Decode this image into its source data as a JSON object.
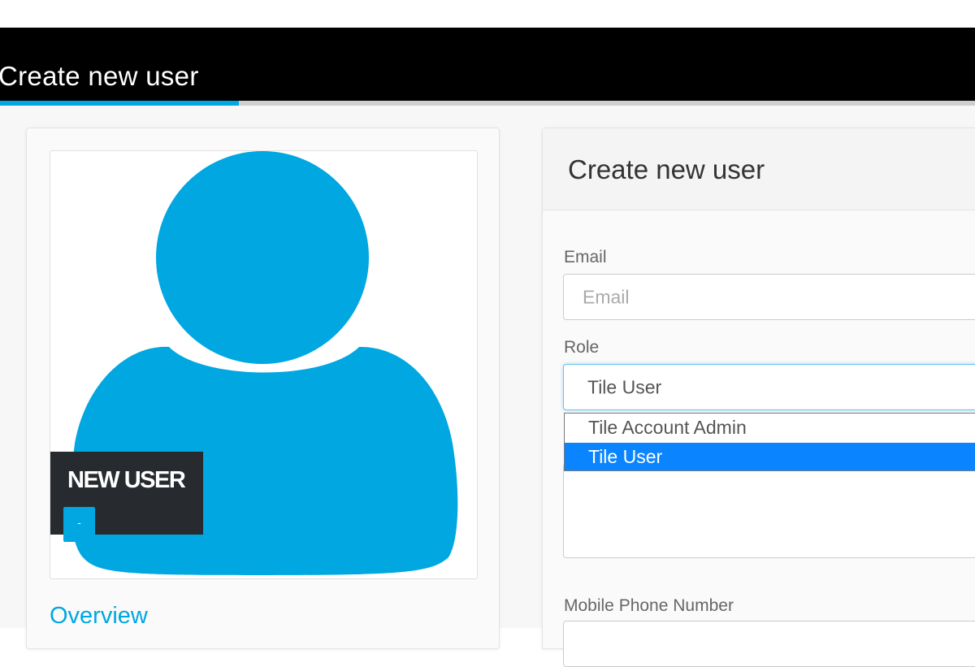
{
  "page": {
    "title": "Create new user"
  },
  "progress": {
    "fraction": 0.245,
    "accent": "#00a7e1"
  },
  "profile": {
    "avatar_icon": "user-silhouette-icon",
    "name": "NEW USER",
    "badge": "-",
    "overview_link": "Overview"
  },
  "form": {
    "title": "Create new user",
    "email": {
      "label": "Email",
      "value": "",
      "placeholder": "Email"
    },
    "role": {
      "label": "Role",
      "selected": "Tile User",
      "options": [
        "Tile Account Admin",
        "Tile User"
      ],
      "highlighted_index": 1
    },
    "mobile": {
      "label": "Mobile Phone Number"
    }
  },
  "colors": {
    "accent": "#00a7e1",
    "header_bg": "#000000",
    "selected_option": "#0b84ff"
  }
}
